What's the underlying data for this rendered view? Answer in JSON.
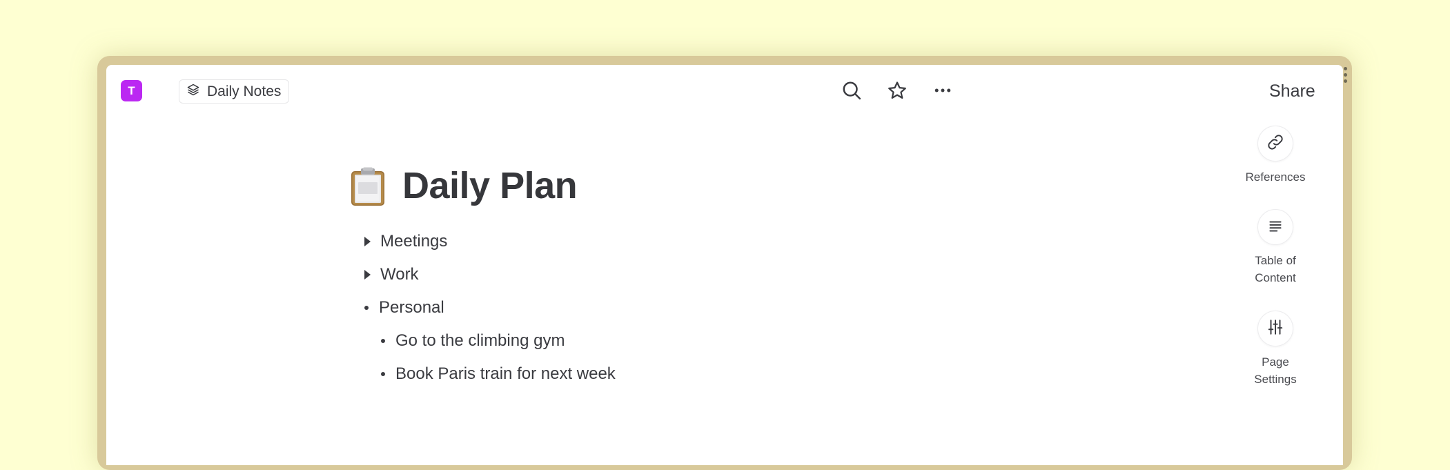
{
  "workspace": {
    "avatar_letter": "T",
    "avatar_color": "#bb28f2"
  },
  "breadcrumb": {
    "icon": "layers-icon",
    "label": "Daily Notes"
  },
  "toolbar": {
    "search_icon": "search-icon",
    "favorite_icon": "star-icon",
    "more_icon": "more-horizontal-icon",
    "share_label": "Share"
  },
  "page": {
    "icon": "clipboard-emoji",
    "title": "Daily Plan",
    "blocks": [
      {
        "type": "toggle",
        "text": "Meetings",
        "level": 0
      },
      {
        "type": "toggle",
        "text": "Work",
        "level": 0
      },
      {
        "type": "bullet",
        "text": "Personal",
        "level": 0
      },
      {
        "type": "bullet",
        "text": "Go to the climbing gym",
        "level": 1
      },
      {
        "type": "bullet",
        "text": "Book Paris train for next week",
        "level": 1
      }
    ]
  },
  "side_panel": {
    "references": {
      "icon": "link-icon",
      "label": "References"
    },
    "toc": {
      "icon": "text-align-icon",
      "label_line1": "Table of",
      "label_line2": "Content"
    },
    "page_settings": {
      "icon": "sliders-icon",
      "label_line1": "Page",
      "label_line2": "Settings"
    }
  },
  "colors": {
    "background": "#feffd2",
    "frame": "#d8c99a",
    "text": "#37383c"
  }
}
